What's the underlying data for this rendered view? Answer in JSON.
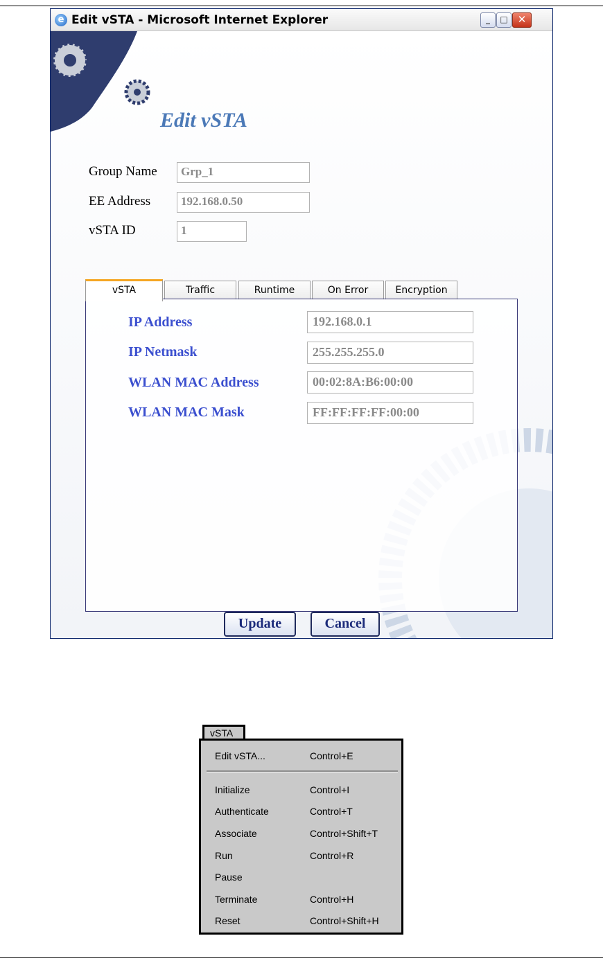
{
  "window": {
    "title": "Edit vSTA - Microsoft Internet Explorer",
    "minimize": "_",
    "maximize": "□",
    "close": "✕",
    "heading": "Edit vSTA"
  },
  "form": {
    "group_name_label": "Group Name",
    "group_name_value": "Grp_1",
    "ee_address_label": "EE Address",
    "ee_address_value": "192.168.0.50",
    "vsta_id_label": "vSTA ID",
    "vsta_id_value": "1"
  },
  "tabs": [
    "vSTA",
    "Traffic",
    "Runtime",
    "On Error",
    "Encryption"
  ],
  "active_tab": "vSTA",
  "vsta_panel": {
    "ip_address_label": "IP Address",
    "ip_address_value": "192.168.0.1",
    "ip_netmask_label": "IP Netmask",
    "ip_netmask_value": "255.255.255.0",
    "wlan_mac_address_label": "WLAN MAC Address",
    "wlan_mac_address_value": "00:02:8A:B6:00:00",
    "wlan_mac_mask_label": "WLAN MAC Mask",
    "wlan_mac_mask_value": "FF:FF:FF:FF:00:00"
  },
  "buttons": {
    "update": "Update",
    "cancel": "Cancel"
  },
  "menu": {
    "title": "vSTA",
    "items": [
      {
        "label": "Edit vSTA...",
        "shortcut": "Control+E"
      },
      {
        "label": "Initialize",
        "shortcut": "Control+I"
      },
      {
        "label": "Authenticate",
        "shortcut": "Control+T"
      },
      {
        "label": "Associate",
        "shortcut": "Control+Shift+T"
      },
      {
        "label": "Run",
        "shortcut": "Control+R"
      },
      {
        "label": "Pause",
        "shortcut": ""
      },
      {
        "label": "Terminate",
        "shortcut": "Control+H"
      },
      {
        "label": "Reset",
        "shortcut": "Control+Shift+H"
      }
    ]
  },
  "colors": {
    "heading": "#4b79b7",
    "field_label": "#3b4fcf",
    "active_tab_accent": "#f5a623",
    "button_text": "#1b2a7a"
  }
}
